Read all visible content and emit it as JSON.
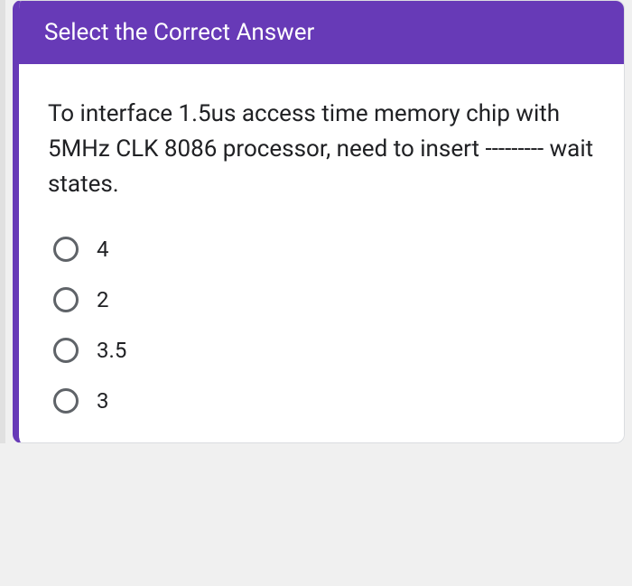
{
  "header": {
    "title": "Select the Correct Answer"
  },
  "question": {
    "text": "To interface 1.5us access time memory chip with 5MHz CLK 8086 processor, need to insert --------- wait states."
  },
  "options": [
    {
      "label": "4"
    },
    {
      "label": "2"
    },
    {
      "label": "3.5"
    },
    {
      "label": "3"
    }
  ]
}
